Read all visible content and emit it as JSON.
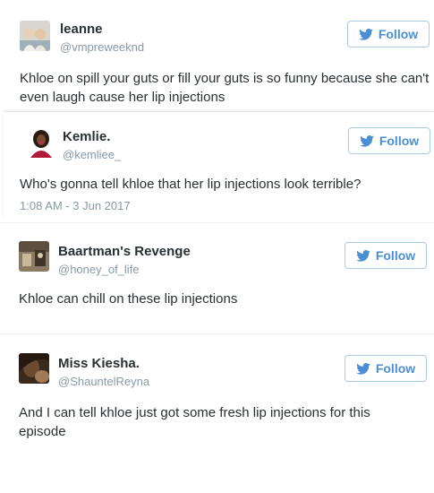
{
  "brand_color": "#1da1f2",
  "tweets": [
    {
      "name": "leanne",
      "handle": "@vmpreweeknd",
      "text": "Khloe on spill your guts or fill your guts is so funny because she can't even laugh cause her lip injections",
      "follow_label": "Follow",
      "follow_icon": "twitter-bird-icon"
    },
    {
      "name": "Kemlie.",
      "handle": "@kemliee_",
      "text": "Who's gonna tell khloe that her lip injections look terrible?",
      "timestamp": "1:08 AM - 3 Jun 2017",
      "follow_label": "Follow",
      "follow_icon": "twitter-bird-icon"
    },
    {
      "name": "Baartman's Revenge",
      "handle": "@honey_of_life",
      "text": "Khloe can chill on these lip injections",
      "follow_label": "Follow",
      "follow_icon": "twitter-bird-icon"
    },
    {
      "name": "Miss Kiesha.",
      "handle": "@ShauntelReyna",
      "text": "And I can tell khloe just got some fresh lip injections for this episode",
      "follow_label": "Follow",
      "follow_icon": "twitter-bird-icon"
    }
  ]
}
